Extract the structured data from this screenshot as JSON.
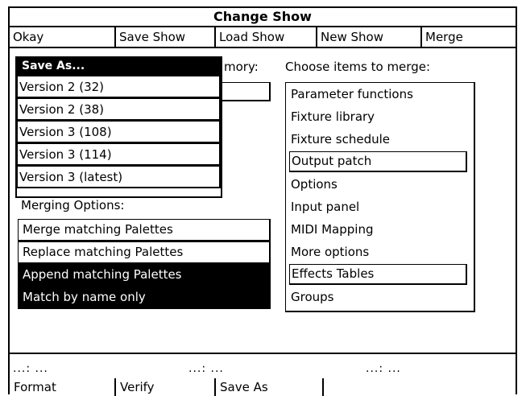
{
  "window": {
    "title": "Change Show"
  },
  "menu": {
    "okay": "Okay",
    "save_show": "Save Show",
    "load_show": "Load Show",
    "new_show": "New Show",
    "merge": "Merge"
  },
  "save_as_menu": {
    "title": "Save As...",
    "items": [
      "Version 2 (32)",
      "Version 2 (38)",
      "Version 3 (108)",
      "Version 3 (114)",
      "Version 3 (latest)"
    ]
  },
  "memory_label_fragment": "e mory:",
  "merge_panel": {
    "heading": "Choose items to merge:",
    "items": [
      "Parameter functions",
      "Fixture library",
      "Fixture schedule",
      "Output patch",
      "Options",
      "Input panel",
      "MIDI Mapping",
      "More options",
      "Effects Tables",
      "Groups"
    ],
    "boxed": [
      false,
      false,
      false,
      true,
      false,
      false,
      false,
      false,
      true,
      false
    ]
  },
  "merging_options": {
    "heading": "Merging Options:",
    "items": [
      "Merge matching Palettes",
      "Replace matching Palettes",
      "Append matching Palettes",
      "Match by name only"
    ],
    "selected": [
      false,
      false,
      true,
      true
    ]
  },
  "status": {
    "dots": [
      "...: ...",
      "...: ...",
      "...: ..."
    ]
  },
  "function_keys": [
    "Format",
    "Verify",
    "Save As"
  ]
}
